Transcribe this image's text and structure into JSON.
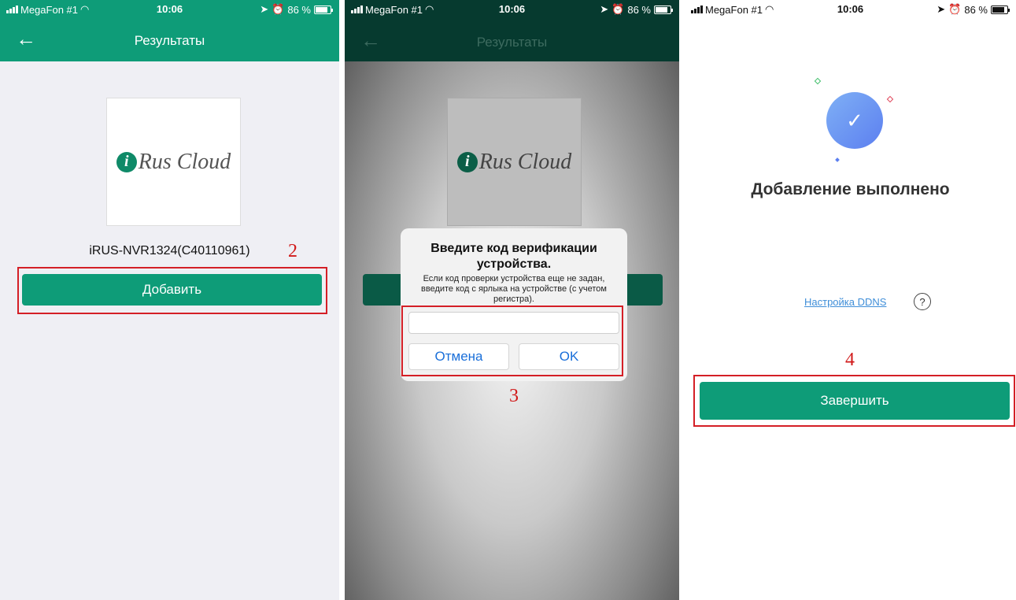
{
  "status_bar": {
    "carrier": "MegaFon #1",
    "time": "10:06",
    "battery": "86 %"
  },
  "panel1": {
    "nav_title": "Результаты",
    "logo_text": "Rus Cloud",
    "device_name": "iRUS-NVR1324(C40110961)",
    "step_number": "2",
    "add_button": "Добавить"
  },
  "panel2": {
    "nav_title": "Результаты",
    "logo_text": "Rus Cloud",
    "dialog_title": "Введите код верификации устройства.",
    "dialog_message": "Если код проверки устройства еще не задан, введите код с ярлыка на устройстве (с учетом регистра).",
    "cancel_button": "Отмена",
    "ok_button": "OK",
    "step_number": "3"
  },
  "panel3": {
    "success_title": "Добавление выполнено",
    "ddns_link": "Настройка DDNS",
    "help_icon_text": "?",
    "step_number": "4",
    "finish_button": "Завершить"
  },
  "colors": {
    "brand_green": "#0e9c78",
    "annotation_red": "#d41f26",
    "link_blue": "#3f8ed8"
  }
}
